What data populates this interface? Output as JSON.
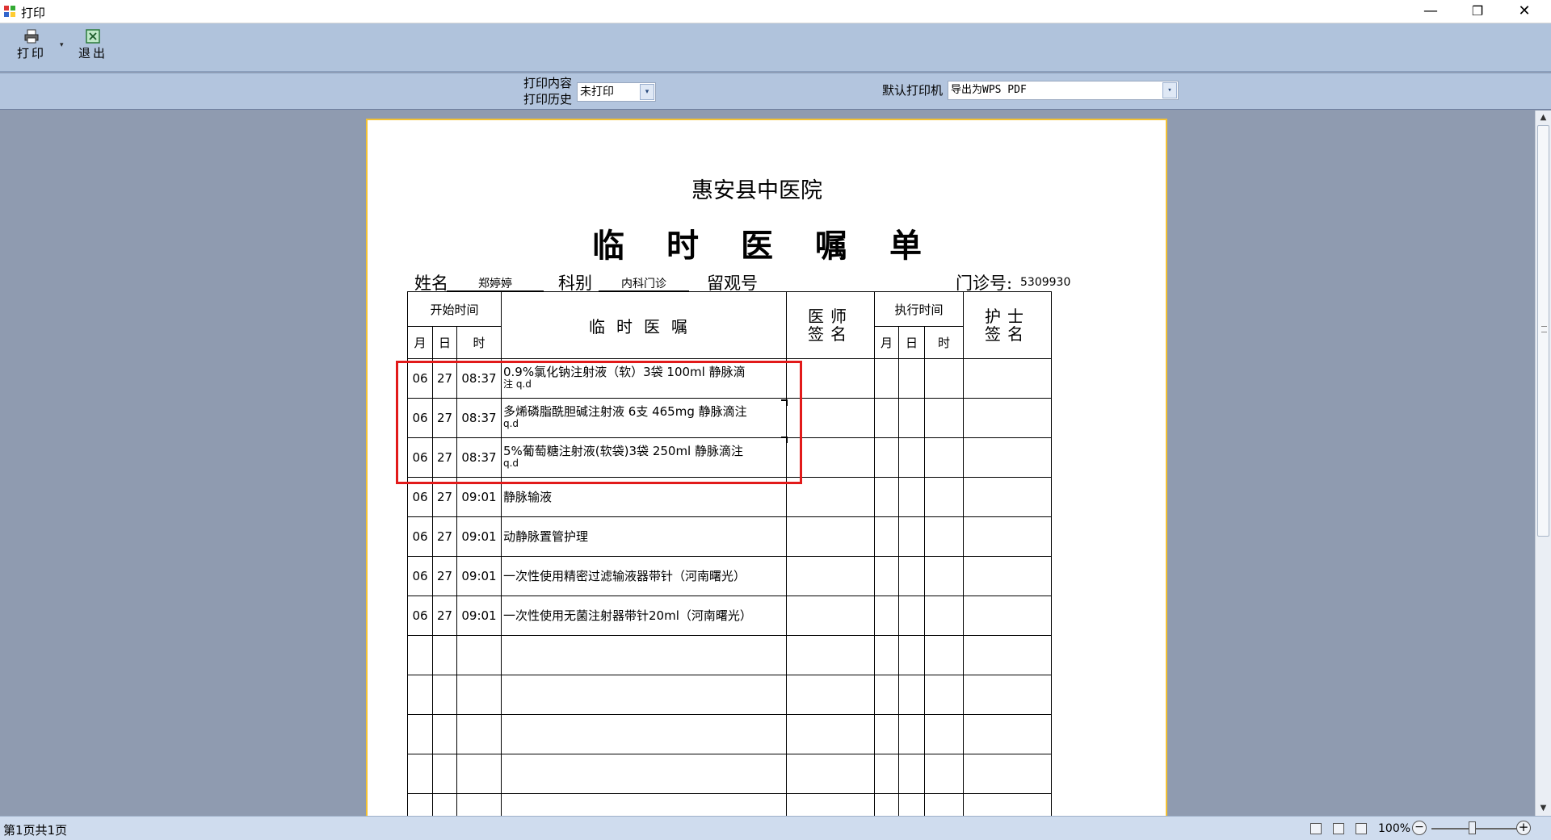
{
  "window": {
    "title": "打印",
    "minimize": "—",
    "maximize": "❐",
    "close": "✕"
  },
  "toolbar": {
    "print_label": "打印",
    "dropdown": "▾",
    "exit_label": "退出"
  },
  "options": {
    "print_content_label": "打印内容",
    "print_history_label": "打印历史",
    "print_content_value": "未打印",
    "default_printer_label": "默认打印机",
    "printer_value": "导出为WPS PDF",
    "arrow": "▾"
  },
  "document": {
    "hospital": "惠安县中医院",
    "title": "临时医嘱单",
    "name_label": "姓名",
    "name_value": "郑婷婷",
    "dept_label": "科别",
    "dept_value": "内科门诊",
    "obs_label": "留观号",
    "clinic_label": "门诊号:",
    "clinic_value": "5309930",
    "headers": {
      "start_time": "开始时间",
      "month": "月",
      "day": "日",
      "time": "时",
      "order": "临时医嘱",
      "doctor_sign_1": "医师",
      "doctor_sign_2": "签名",
      "exec_time": "执行时间",
      "nurse_sign_1": "护士",
      "nurse_sign_2": "签名"
    },
    "rows": [
      {
        "m": "06",
        "d": "27",
        "t": "08:37",
        "text": "0.9%氯化钠注射液（软）3袋    100ml    静脉滴",
        "sub": "注 q.d"
      },
      {
        "m": "06",
        "d": "27",
        "t": "08:37",
        "text": "多烯磷脂酰胆碱注射液 6支     465mg    静脉滴注",
        "sub": "q.d"
      },
      {
        "m": "06",
        "d": "27",
        "t": "08:37",
        "text": "5%葡萄糖注射液(软袋)3袋     250ml    静脉滴注",
        "sub": "q.d"
      },
      {
        "m": "06",
        "d": "27",
        "t": "09:01",
        "text": "静脉输液",
        "sub": ""
      },
      {
        "m": "06",
        "d": "27",
        "t": "09:01",
        "text": "动静脉置管护理",
        "sub": ""
      },
      {
        "m": "06",
        "d": "27",
        "t": "09:01",
        "text": "一次性使用精密过滤输液器带针（河南曙光）",
        "sub": ""
      },
      {
        "m": "06",
        "d": "27",
        "t": "09:01",
        "text": "一次性使用无菌注射器带针20ml（河南曙光）",
        "sub": ""
      },
      {
        "m": "",
        "d": "",
        "t": "",
        "text": "",
        "sub": ""
      },
      {
        "m": "",
        "d": "",
        "t": "",
        "text": "",
        "sub": ""
      },
      {
        "m": "",
        "d": "",
        "t": "",
        "text": "",
        "sub": ""
      },
      {
        "m": "",
        "d": "",
        "t": "",
        "text": "",
        "sub": ""
      },
      {
        "m": "",
        "d": "",
        "t": "",
        "text": "",
        "sub": ""
      }
    ]
  },
  "scrollbar": {
    "up": "▲",
    "down": "▼"
  },
  "status": {
    "page_info": "第1页共1页",
    "zoom": "100%",
    "zoom_out": "−",
    "zoom_in": "+"
  },
  "colors": {
    "highlight": "#e21a1a",
    "paper_border": "#f3c132",
    "toolbar": "#b0c3dc"
  }
}
